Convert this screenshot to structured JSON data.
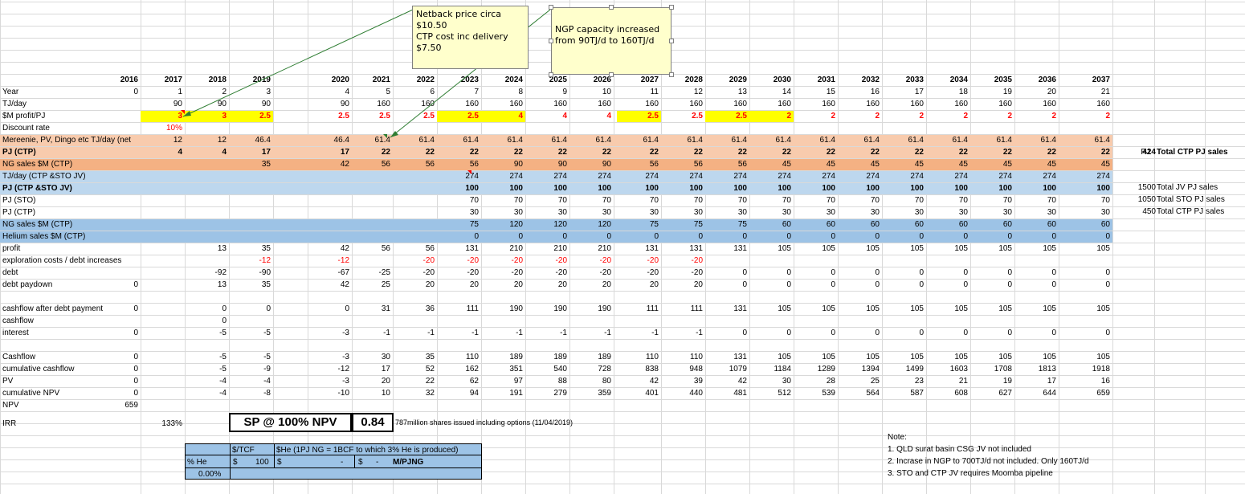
{
  "years": [
    "2016",
    "2017",
    "2018",
    "2019",
    "2020",
    "2021",
    "2022",
    "2023",
    "2024",
    "2025",
    "2026",
    "2027",
    "2028",
    "2029",
    "2030",
    "2031",
    "2032",
    "2033",
    "2034",
    "2035",
    "2036",
    "2037"
  ],
  "colors": {
    "orange_light": "#f8cbad",
    "orange_dark": "#f4b183",
    "blue_light": "#bdd7ee",
    "blue_dark": "#9dc3e6",
    "yellow": "#ffff00",
    "red": "#ff0000",
    "note_bg": "#ffffcc",
    "arrow": "#2e7d32"
  },
  "rows": [
    {
      "label": "Year",
      "values": [
        "0",
        "1",
        "2",
        "3",
        "4",
        "5",
        "6",
        "7",
        "8",
        "9",
        "10",
        "11",
        "12",
        "13",
        "14",
        "15",
        "16",
        "17",
        "18",
        "19",
        "20",
        "21"
      ]
    },
    {
      "label": "TJ/day",
      "values": [
        "",
        "90",
        "90",
        "90",
        "90",
        "160",
        "160",
        "160",
        "160",
        "160",
        "160",
        "160",
        "160",
        "160",
        "160",
        "160",
        "160",
        "160",
        "160",
        "160",
        "160",
        "160"
      ]
    },
    {
      "label": "$M profit/PJ",
      "values": [
        "",
        "3",
        "3",
        "2.5",
        "2.5",
        "2.5",
        "2.5",
        "2.5",
        "4",
        "4",
        "4",
        "2.5",
        "2.5",
        "2.5",
        "2",
        "2",
        "2",
        "2",
        "2",
        "2",
        "2",
        "2"
      ]
    },
    {
      "label": "Discount rate",
      "values": [
        "",
        "10%",
        "",
        "",
        "",
        "",
        "",
        "",
        "",
        "",
        "",
        "",
        "",
        "",
        "",
        "",
        "",
        "",
        "",
        "",
        "",
        ""
      ]
    },
    {
      "label": "Mereenie, PV, Dingo etc TJ/day (net",
      "values": [
        "",
        "12",
        "12",
        "46.4",
        "46.4",
        "61.4",
        "61.4",
        "61.4",
        "61.4",
        "61.4",
        "61.4",
        "61.4",
        "61.4",
        "61.4",
        "61.4",
        "61.4",
        "61.4",
        "61.4",
        "61.4",
        "61.4",
        "61.4",
        "61.4"
      ]
    },
    {
      "label": "PJ (CTP)",
      "values": [
        "",
        "4",
        "4",
        "17",
        "17",
        "22",
        "22",
        "22",
        "22",
        "22",
        "22",
        "22",
        "22",
        "22",
        "22",
        "22",
        "22",
        "22",
        "22",
        "22",
        "22",
        "22"
      ]
    },
    {
      "label": "NG sales $M (CTP)",
      "values": [
        "",
        "",
        "",
        "35",
        "42",
        "56",
        "56",
        "56",
        "90",
        "90",
        "90",
        "56",
        "56",
        "56",
        "45",
        "45",
        "45",
        "45",
        "45",
        "45",
        "45",
        "45"
      ]
    },
    {
      "label": "TJ/day (CTP &STO JV)",
      "values": [
        "",
        "",
        "",
        "",
        "",
        "",
        "",
        "274",
        "274",
        "274",
        "274",
        "274",
        "274",
        "274",
        "274",
        "274",
        "274",
        "274",
        "274",
        "274",
        "274",
        "274"
      ]
    },
    {
      "label": "PJ (CTP &STO JV)",
      "values": [
        "",
        "",
        "",
        "",
        "",
        "",
        "",
        "100",
        "100",
        "100",
        "100",
        "100",
        "100",
        "100",
        "100",
        "100",
        "100",
        "100",
        "100",
        "100",
        "100",
        "100"
      ]
    },
    {
      "label": "PJ (STO)",
      "values": [
        "",
        "",
        "",
        "",
        "",
        "",
        "",
        "70",
        "70",
        "70",
        "70",
        "70",
        "70",
        "70",
        "70",
        "70",
        "70",
        "70",
        "70",
        "70",
        "70",
        "70"
      ]
    },
    {
      "label": "PJ (CTP)",
      "values": [
        "",
        "",
        "",
        "",
        "",
        "",
        "",
        "30",
        "30",
        "30",
        "30",
        "30",
        "30",
        "30",
        "30",
        "30",
        "30",
        "30",
        "30",
        "30",
        "30",
        "30"
      ]
    },
    {
      "label": "NG sales $M (CTP)",
      "values": [
        "",
        "",
        "",
        "",
        "",
        "",
        "",
        "75",
        "120",
        "120",
        "120",
        "75",
        "75",
        "75",
        "60",
        "60",
        "60",
        "60",
        "60",
        "60",
        "60",
        "60"
      ]
    },
    {
      "label": "Helium sales  $M (CTP)",
      "values": [
        "",
        "",
        "",
        "",
        "",
        "",
        "",
        "0",
        "0",
        "0",
        "0",
        "0",
        "0",
        "0",
        "0",
        "0",
        "0",
        "0",
        "0",
        "0",
        "0",
        "0"
      ]
    },
    {
      "label": "profit",
      "values": [
        "",
        "",
        "13",
        "35",
        "42",
        "56",
        "56",
        "131",
        "210",
        "210",
        "210",
        "131",
        "131",
        "131",
        "105",
        "105",
        "105",
        "105",
        "105",
        "105",
        "105",
        "105"
      ]
    },
    {
      "label": "exploration costs / debt increases",
      "values": [
        "",
        "",
        "",
        "-12",
        "-12",
        "",
        "-20",
        "-20",
        "-20",
        "-20",
        "-20",
        "-20",
        "-20",
        "",
        "",
        "",
        "",
        "",
        "",
        "",
        "",
        ""
      ]
    },
    {
      "label": "debt",
      "values": [
        "",
        "",
        "-92",
        "-90",
        "-67",
        "-25",
        "-20",
        "-20",
        "-20",
        "-20",
        "-20",
        "-20",
        "-20",
        "0",
        "0",
        "0",
        "0",
        "0",
        "0",
        "0",
        "0",
        "0"
      ]
    },
    {
      "label": "debt paydown",
      "values": [
        "0",
        "",
        "13",
        "35",
        "42",
        "25",
        "20",
        "20",
        "20",
        "20",
        "20",
        "20",
        "20",
        "0",
        "0",
        "0",
        "0",
        "0",
        "0",
        "0",
        "0",
        "0"
      ]
    },
    {
      "label": "",
      "values": [
        "",
        "",
        "",
        "",
        "",
        "",
        "",
        "",
        "",
        "",
        "",
        "",
        "",
        "",
        "",
        "",
        "",
        "",
        "",
        "",
        "",
        ""
      ]
    },
    {
      "label": "cashflow after debt payment",
      "values": [
        "0",
        "",
        "0",
        "0",
        "0",
        "31",
        "36",
        "111",
        "190",
        "190",
        "190",
        "111",
        "111",
        "131",
        "105",
        "105",
        "105",
        "105",
        "105",
        "105",
        "105",
        "105"
      ]
    },
    {
      "label": "cashflow",
      "values": [
        "",
        "",
        "0",
        "",
        "",
        "",
        "",
        "",
        "",
        "",
        "",
        "",
        "",
        "",
        "",
        "",
        "",
        "",
        "",
        "",
        "",
        ""
      ]
    },
    {
      "label": "interest",
      "values": [
        "0",
        "",
        "-5",
        "-5",
        "-3",
        "-1",
        "-1",
        "-1",
        "-1",
        "-1",
        "-1",
        "-1",
        "-1",
        "0",
        "0",
        "0",
        "0",
        "0",
        "0",
        "0",
        "0",
        "0"
      ]
    },
    {
      "label": "",
      "values": [
        "",
        "",
        "",
        "",
        "",
        "",
        "",
        "",
        "",
        "",
        "",
        "",
        "",
        "",
        "",
        "",
        "",
        "",
        "",
        "",
        "",
        ""
      ]
    },
    {
      "label": "Cashflow",
      "values": [
        "0",
        "",
        "-5",
        "-5",
        "-3",
        "30",
        "35",
        "110",
        "189",
        "189",
        "189",
        "110",
        "110",
        "131",
        "105",
        "105",
        "105",
        "105",
        "105",
        "105",
        "105",
        "105"
      ]
    },
    {
      "label": "cumulative cashflow",
      "values": [
        "0",
        "",
        "-5",
        "-9",
        "-12",
        "17",
        "52",
        "162",
        "351",
        "540",
        "728",
        "838",
        "948",
        "1079",
        "1184",
        "1289",
        "1394",
        "1499",
        "1603",
        "1708",
        "1813",
        "1918"
      ]
    },
    {
      "label": "PV",
      "values": [
        "0",
        "",
        "-4",
        "-4",
        "-3",
        "20",
        "22",
        "62",
        "97",
        "88",
        "80",
        "42",
        "39",
        "42",
        "30",
        "28",
        "25",
        "23",
        "21",
        "19",
        "17",
        "16"
      ]
    },
    {
      "label": "cumulative NPV",
      "values": [
        "0",
        "",
        "-4",
        "-8",
        "-10",
        "10",
        "32",
        "94",
        "191",
        "279",
        "359",
        "401",
        "440",
        "481",
        "512",
        "539",
        "564",
        "587",
        "608",
        "627",
        "644",
        "659"
      ]
    },
    {
      "label": "NPV",
      "values": [
        "659",
        "",
        "",
        "",
        "",
        "",
        "",
        "",
        "",
        "",
        "",
        "",
        "",
        "",
        "",
        "",
        "",
        "",
        "",
        "",
        "",
        ""
      ]
    }
  ],
  "side": {
    "pj_header": "PJ",
    "ctp_total_value": "424",
    "ctp_total_label": "Total CTP PJ sales",
    "jv_value": "1500",
    "jv_label": "Total JV PJ sales",
    "sto_value": "1050",
    "sto_label": "Total STO PJ sales",
    "ctp2_value": "450",
    "ctp2_label": "Total CTP PJ sales"
  },
  "irr": {
    "label": "IRR",
    "value": "133%"
  },
  "sp_box": {
    "label": "SP @ 100% NPV",
    "value": "0.84",
    "note": "787million shares issued including options (11/04/2019)"
  },
  "helium": {
    "tcf_header": "$/TCF",
    "she_header": "$He (1PJ NG = 1BCF to which 3% He is produced)",
    "pct_label": "% He",
    "pct_value": "0.00%",
    "dollar1": "$",
    "tcf_value": "100",
    "dollar2": "$",
    "she_value": "-",
    "dollar3": "$",
    "dash": "-",
    "unit": "M/PJNG"
  },
  "notes": {
    "title": "Note:",
    "items": [
      "1. QLD surat basin CSG JV not included",
      "2. Incrase in NGP to 700TJ/d not included. Only 160TJ/d",
      "3. STO and CTP JV requires Moomba pipeline"
    ]
  },
  "comment1": {
    "lines": [
      "Netback price circa",
      "$10.50",
      "CTP cost inc delivery",
      "$7.50"
    ]
  },
  "comment2": {
    "lines": [
      "NGP capacity increased",
      "from 90TJ/d to 160TJ/d"
    ]
  }
}
